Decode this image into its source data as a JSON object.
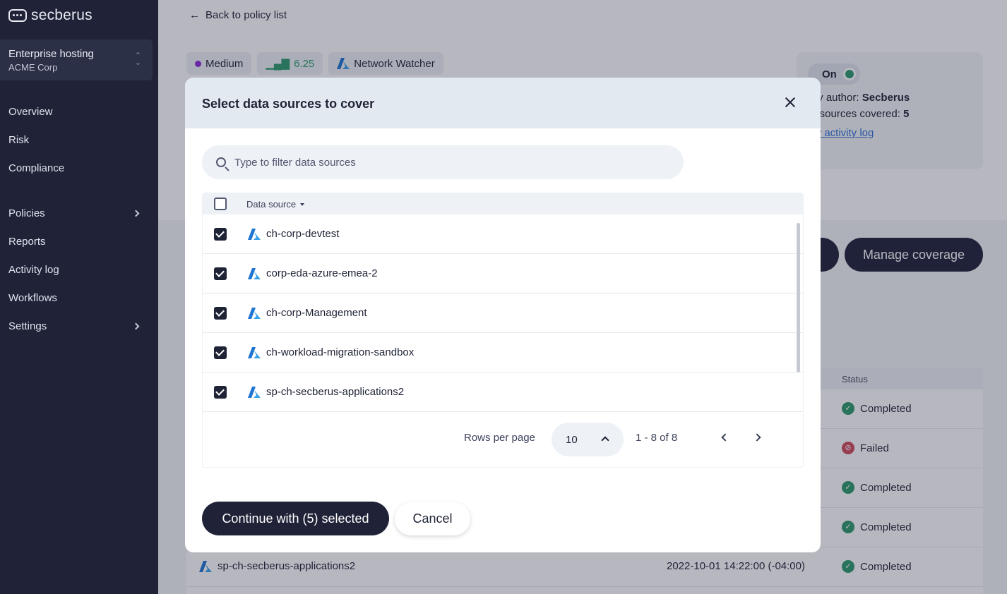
{
  "app": {
    "logo_text": "secberus"
  },
  "sidebar": {
    "org": {
      "name": "Enterprise hosting",
      "sub": "ACME Corp"
    },
    "items": [
      {
        "label": "Overview"
      },
      {
        "label": "Risk"
      },
      {
        "label": "Compliance"
      },
      {
        "label": "Policies"
      },
      {
        "label": "Reports"
      },
      {
        "label": "Activity log"
      },
      {
        "label": "Workflows"
      },
      {
        "label": "Settings"
      }
    ]
  },
  "background": {
    "back_label": "Back to policy list",
    "chips": {
      "severity": "Medium",
      "score": "6.25",
      "service": "Network Watcher"
    },
    "toggle_label": "On",
    "info": {
      "author_label": "licy author:",
      "author_value": "Secberus",
      "covered_label": "ta sources covered:",
      "covered_value": "5",
      "link": "ew activity log"
    },
    "manage_label": "Manage coverage",
    "status_header": "Status",
    "rows": [
      {
        "status": "Completed"
      },
      {
        "status": "Failed"
      },
      {
        "status": "Completed"
      },
      {
        "status": "Completed"
      },
      {
        "name": "sp-ch-secberus-applications2",
        "date": "2022-10-01 14:22:00 (-04:00)",
        "status": "Completed"
      }
    ]
  },
  "modal": {
    "title": "Select data sources to cover",
    "filter_placeholder": "Type to filter data sources",
    "column_header": "Data source",
    "rows": [
      {
        "name": "ch-corp-devtest"
      },
      {
        "name": "corp-eda-azure-emea-2"
      },
      {
        "name": "ch-corp-Management"
      },
      {
        "name": "ch-workload-migration-sandbox"
      },
      {
        "name": "sp-ch-secberus-applications2"
      }
    ],
    "pagination": {
      "rows_per_page_label": "Rows per page",
      "rows_per_page": "10",
      "range": "1 - 8 of 8"
    },
    "continue_label": "Continue with (5) selected",
    "cancel_label": "Cancel"
  },
  "colors": {
    "sidebar": "#202338",
    "accent_dark": "#202338",
    "success": "#2f9a6e",
    "danger": "#d04a5e",
    "severity_medium": "#8b2bd8",
    "azure": "#1f75d1"
  }
}
